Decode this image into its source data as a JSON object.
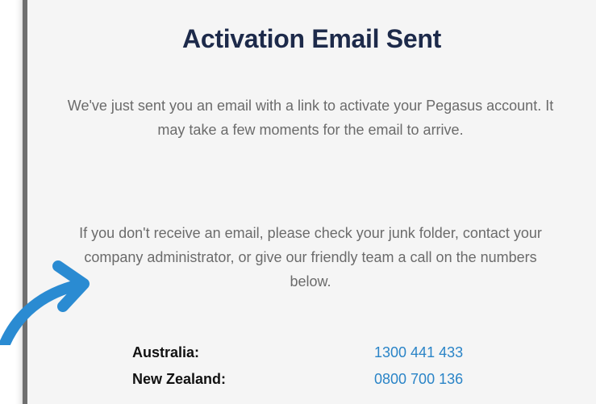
{
  "heading": "Activation Email Sent",
  "paragraphs": {
    "sent": "We've just sent you an email with a link to activate your Pegasus account. It may take a few moments for the email to arrive.",
    "help": "If you don't receive an email, please check your junk folder, contact your company administrator, or give our friendly team a call on the numbers below."
  },
  "contacts": [
    {
      "country": "Australia:",
      "phone": "1300 441 433"
    },
    {
      "country": "New Zealand:",
      "phone": "0800 700 136"
    }
  ],
  "colors": {
    "heading": "#1d2a4a",
    "body_text": "#6b6b6b",
    "link": "#2a84c7",
    "arrow": "#2a8bd2",
    "panel_bg": "#f5f5f5",
    "panel_border": "#6f6f6f"
  },
  "icons": {
    "annotation_arrow": "curved-arrow-right-icon"
  }
}
